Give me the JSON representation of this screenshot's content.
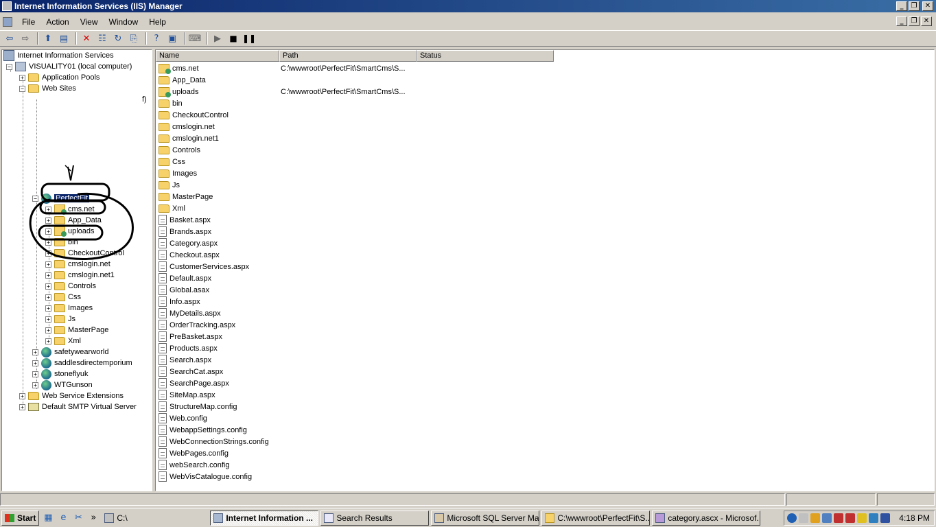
{
  "window": {
    "title": "Internet Information Services (IIS) Manager"
  },
  "menu": {
    "items": [
      "File",
      "Action",
      "View",
      "Window",
      "Help"
    ]
  },
  "toolbar": {
    "icons": [
      "back-icon",
      "forward-icon",
      "up-folder-icon",
      "show-tree-icon",
      "delete-icon",
      "properties-icon",
      "refresh-icon",
      "export-icon",
      "help-icon",
      "console-icon",
      "computer-icon",
      "play-icon",
      "stop-icon",
      "pause-icon"
    ]
  },
  "tree": {
    "root": "Internet Information Services",
    "computer": "VISUALITY01 (local computer)",
    "app_pools": "Application Pools",
    "web_sites": "Web Sites",
    "site_perfectfit": "PerfectFit",
    "children": [
      "cms.net",
      "App_Data",
      "uploads",
      "bin",
      "CheckoutControl",
      "cmslogin.net",
      "cmslogin.net1",
      "Controls",
      "Css",
      "Images",
      "Js",
      "MasterPage",
      "Xml"
    ],
    "other_sites": [
      "safetywearworld",
      "saddlesdirectemporium",
      "stoneflyuk",
      "WTGunson"
    ],
    "web_service_extensions": "Web Service Extensions",
    "smtp": "Default SMTP Virtual Server",
    "partial_text": "f)"
  },
  "list": {
    "columns": [
      "Name",
      "Path",
      "Status"
    ],
    "rows": [
      {
        "name": "cms.net",
        "path": "C:\\wwwroot\\PerfectFit\\SmartCms\\S...",
        "icon": "vdir"
      },
      {
        "name": "App_Data",
        "path": "",
        "icon": "folder"
      },
      {
        "name": "uploads",
        "path": "C:\\wwwroot\\PerfectFit\\SmartCms\\S...",
        "icon": "vdir"
      },
      {
        "name": "bin",
        "path": "",
        "icon": "folder"
      },
      {
        "name": "CheckoutControl",
        "path": "",
        "icon": "folder"
      },
      {
        "name": "cmslogin.net",
        "path": "",
        "icon": "folder"
      },
      {
        "name": "cmslogin.net1",
        "path": "",
        "icon": "folder"
      },
      {
        "name": "Controls",
        "path": "",
        "icon": "folder"
      },
      {
        "name": "Css",
        "path": "",
        "icon": "folder"
      },
      {
        "name": "Images",
        "path": "",
        "icon": "folder"
      },
      {
        "name": "Js",
        "path": "",
        "icon": "folder"
      },
      {
        "name": "MasterPage",
        "path": "",
        "icon": "folder"
      },
      {
        "name": "Xml",
        "path": "",
        "icon": "folder"
      },
      {
        "name": "Basket.aspx",
        "path": "",
        "icon": "file"
      },
      {
        "name": "Brands.aspx",
        "path": "",
        "icon": "file"
      },
      {
        "name": "Category.aspx",
        "path": "",
        "icon": "file"
      },
      {
        "name": "Checkout.aspx",
        "path": "",
        "icon": "file"
      },
      {
        "name": "CustomerServices.aspx",
        "path": "",
        "icon": "file"
      },
      {
        "name": "Default.aspx",
        "path": "",
        "icon": "file"
      },
      {
        "name": "Global.asax",
        "path": "",
        "icon": "file"
      },
      {
        "name": "Info.aspx",
        "path": "",
        "icon": "file"
      },
      {
        "name": "MyDetails.aspx",
        "path": "",
        "icon": "file"
      },
      {
        "name": "OrderTracking.aspx",
        "path": "",
        "icon": "file"
      },
      {
        "name": "PreBasket.aspx",
        "path": "",
        "icon": "file"
      },
      {
        "name": "Products.aspx",
        "path": "",
        "icon": "file"
      },
      {
        "name": "Search.aspx",
        "path": "",
        "icon": "file"
      },
      {
        "name": "SearchCat.aspx",
        "path": "",
        "icon": "file"
      },
      {
        "name": "SearchPage.aspx",
        "path": "",
        "icon": "file"
      },
      {
        "name": "SiteMap.aspx",
        "path": "",
        "icon": "file"
      },
      {
        "name": "StructureMap.config",
        "path": "",
        "icon": "file"
      },
      {
        "name": "Web.config",
        "path": "",
        "icon": "file"
      },
      {
        "name": "WebappSettings.config",
        "path": "",
        "icon": "file"
      },
      {
        "name": "WebConnectionStrings.config",
        "path": "",
        "icon": "file"
      },
      {
        "name": "WebPages.config",
        "path": "",
        "icon": "file"
      },
      {
        "name": "webSearch.config",
        "path": "",
        "icon": "file"
      },
      {
        "name": "WebVisCatalogue.config",
        "path": "",
        "icon": "file"
      }
    ]
  },
  "taskbar": {
    "start": "Start",
    "address": "C:\\",
    "tasks": [
      "Internet Information ...",
      "Search Results",
      "Microsoft SQL Server Ma...",
      "C:\\wwwroot\\PerfectFit\\S...",
      "category.ascx - Microsof..."
    ],
    "clock": "4:18 PM"
  },
  "colors": {
    "titlebar": "#0a246a",
    "face": "#d4d0c8",
    "selection": "#0a246a"
  }
}
